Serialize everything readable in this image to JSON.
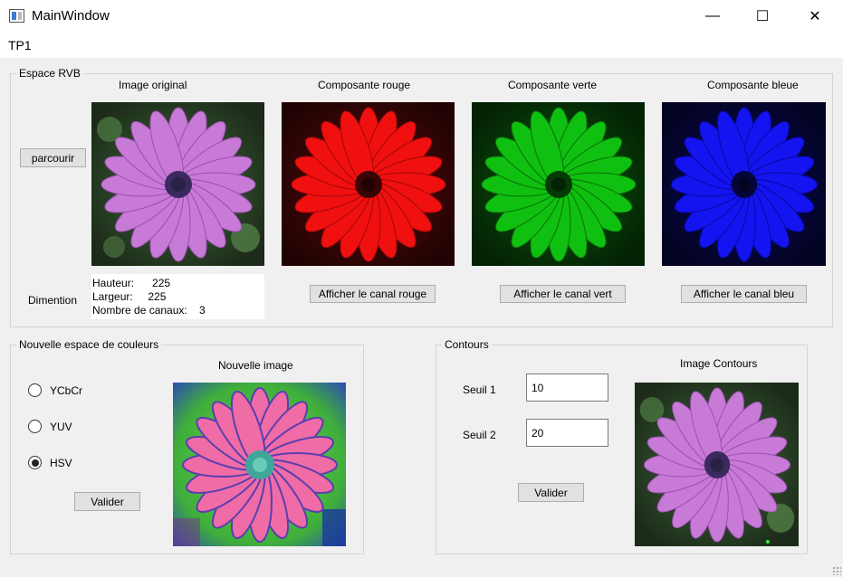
{
  "window": {
    "title": "MainWindow",
    "minimize": "—",
    "maximize": "☐",
    "close": "✕"
  },
  "menu": {
    "item": "TP1"
  },
  "rvb": {
    "group_title": "Espace RVB",
    "browse_label": "parcourir",
    "headers": {
      "original": "Image original",
      "red": "Composante rouge",
      "green": "Composante verte",
      "blue": "Composante bleue"
    },
    "dimension_label": "Dimention",
    "info": {
      "height": "Hauteur:      225",
      "width": "Largeur:     225",
      "channels": "Nombre de canaux:    3"
    },
    "buttons": {
      "red": "Afficher le canal rouge",
      "green": "Afficher le canal vert",
      "blue": "Afficher le canal bleu"
    }
  },
  "color_space": {
    "group_title": "Nouvelle espace de couleurs",
    "options": [
      {
        "label": "YCbCr",
        "checked": false
      },
      {
        "label": "YUV",
        "checked": false
      },
      {
        "label": "HSV",
        "checked": true
      }
    ],
    "image_label": "Nouvelle image",
    "validate_label": "Valider"
  },
  "contours": {
    "group_title": "Contours",
    "threshold1_label": "Seuil 1",
    "threshold1_value": "10",
    "threshold2_label": "Seuil 2",
    "threshold2_value": "20",
    "image_label": "Image Contours",
    "validate_label": "Valider"
  },
  "colors": {
    "petal": "#c77ad6",
    "petal_light": "#e3a6ef",
    "red_petal": "#f01010",
    "green_petal": "#10c010",
    "blue_petal": "#1414f0",
    "hsv_petal": "#f06ca6",
    "hsv_bg": "#4acc3c"
  }
}
